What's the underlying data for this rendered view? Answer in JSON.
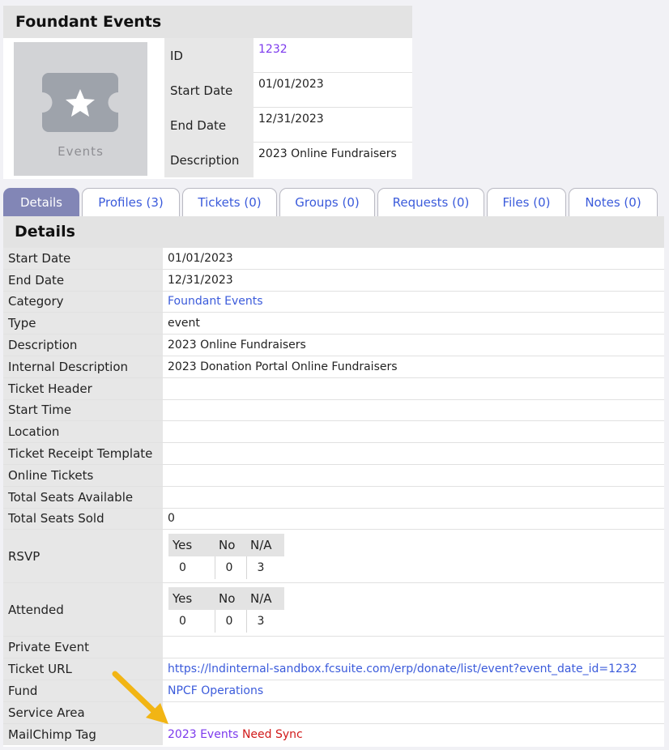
{
  "header": {
    "title": "Foundant Events"
  },
  "thumbnail": {
    "icon": "ticket-star-icon",
    "label": "Events"
  },
  "info": [
    {
      "label": "ID",
      "value": "1232",
      "style": "purple"
    },
    {
      "label": "Start Date",
      "value": "01/01/2023",
      "style": ""
    },
    {
      "label": "End Date",
      "value": "12/31/2023",
      "style": ""
    },
    {
      "label": "Description",
      "value": "2023 Online Fundraisers",
      "style": ""
    }
  ],
  "tabs": [
    {
      "label": "Details",
      "active": true
    },
    {
      "label": "Profiles (3)",
      "active": false
    },
    {
      "label": "Tickets (0)",
      "active": false
    },
    {
      "label": "Groups (0)",
      "active": false
    },
    {
      "label": "Requests (0)",
      "active": false
    },
    {
      "label": "Files (0)",
      "active": false
    },
    {
      "label": "Notes (0)",
      "active": false
    }
  ],
  "details": {
    "title": "Details",
    "rows": [
      {
        "label": "Start Date",
        "value": "01/01/2023"
      },
      {
        "label": "End Date",
        "value": "12/31/2023"
      },
      {
        "label": "Category",
        "value": "Foundant Events",
        "link": true
      },
      {
        "label": "Type",
        "value": "event"
      },
      {
        "label": "Description",
        "value": "2023 Online Fundraisers"
      },
      {
        "label": "Internal Description",
        "value": "2023 Donation Portal Online Fundraisers"
      },
      {
        "label": "Ticket Header",
        "value": ""
      },
      {
        "label": "Start Time",
        "value": ""
      },
      {
        "label": "Location",
        "value": ""
      },
      {
        "label": "Ticket Receipt Template",
        "value": ""
      },
      {
        "label": "Online Tickets",
        "value": ""
      },
      {
        "label": "Total Seats Available",
        "value": ""
      },
      {
        "label": "Total Seats Sold",
        "value": "0"
      }
    ],
    "rsvp": {
      "label": "RSVP",
      "headers": [
        "Yes",
        "No",
        "N/A"
      ],
      "values": [
        "0",
        "0",
        "3"
      ]
    },
    "attended": {
      "label": "Attended",
      "headers": [
        "Yes",
        "No",
        "N/A"
      ],
      "values": [
        "0",
        "0",
        "3"
      ]
    },
    "rows2": [
      {
        "label": "Private Event",
        "value": ""
      },
      {
        "label": "Ticket URL",
        "value": "https://lndinternal-sandbox.fcsuite.com/erp/donate/list/event?event_date_id=1232",
        "link": true
      },
      {
        "label": "Fund",
        "value": "NPCF Operations",
        "link": true
      },
      {
        "label": "Service Area",
        "value": ""
      }
    ],
    "mailchimp": {
      "label": "MailChimp Tag",
      "tag": "2023 Events",
      "status": "Need Sync"
    }
  },
  "annotation": {
    "icon": "arrow-annotation-icon",
    "color": "#f2b514"
  },
  "colors": {
    "link": "#3b5bdb",
    "tag": "#7c3aed",
    "status": "#d11a1a",
    "active_tab": "#8286b6"
  }
}
